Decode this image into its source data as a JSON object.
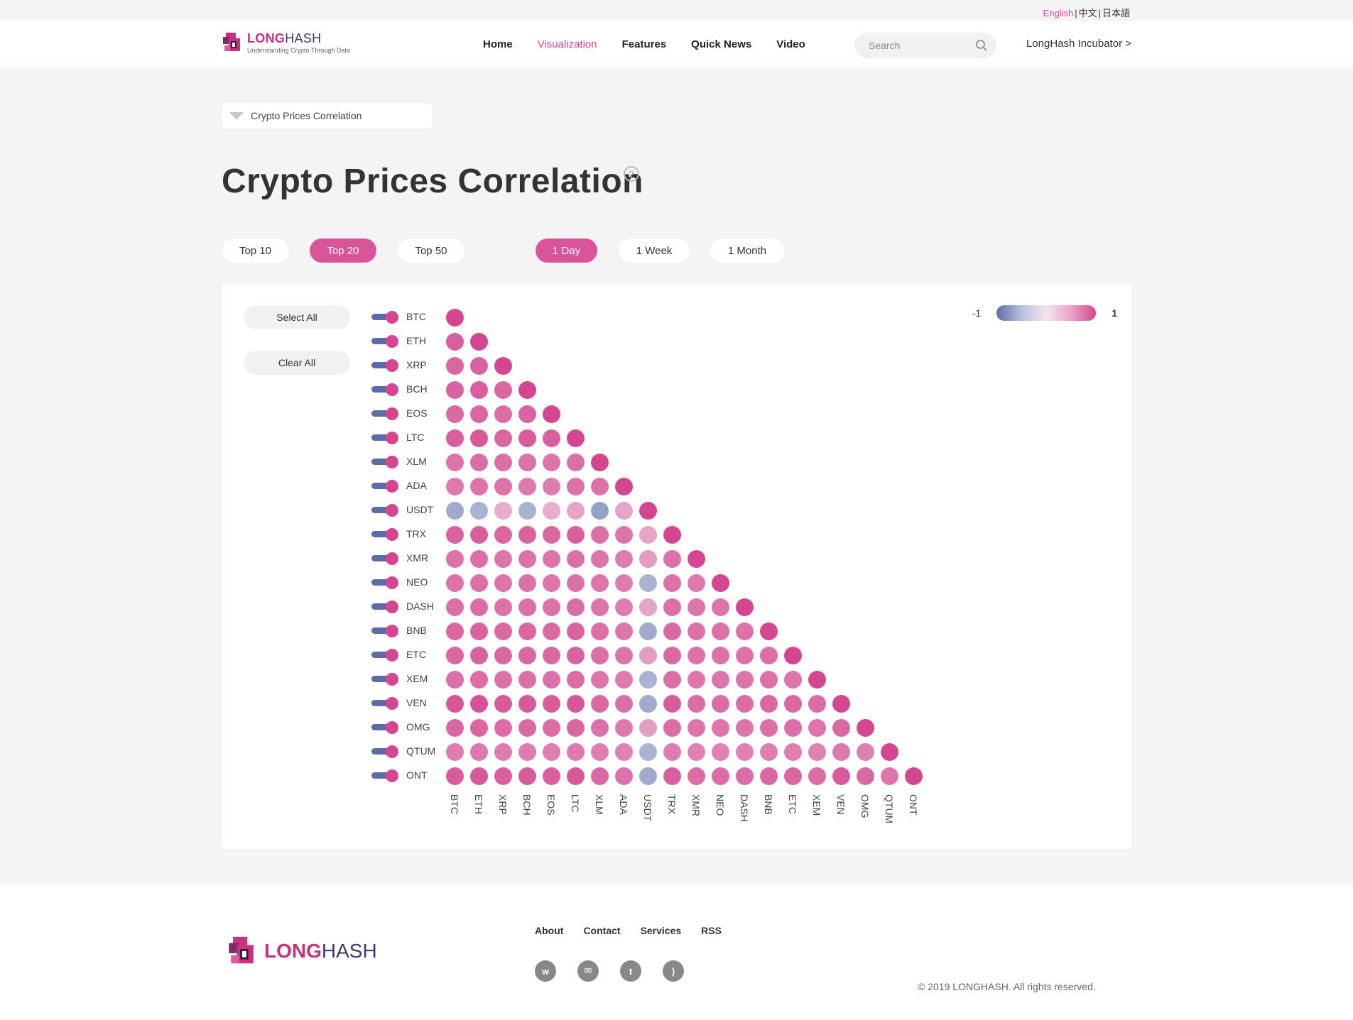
{
  "languages": [
    {
      "label": "English",
      "active": true
    },
    {
      "label": "中文",
      "active": false
    },
    {
      "label": "日本語",
      "active": false
    }
  ],
  "brand": {
    "long": "LONG",
    "hash": "HASH",
    "tagline": "Understanding Crypto Through Data"
  },
  "nav": {
    "items": [
      {
        "label": "Home",
        "active": false
      },
      {
        "label": "Visualization",
        "active": true
      },
      {
        "label": "Features",
        "active": false
      },
      {
        "label": "Quick News",
        "active": false
      },
      {
        "label": "Video",
        "active": false
      }
    ],
    "search_placeholder": "Search",
    "incubator_label": "LongHash Incubator >"
  },
  "dropdown": {
    "selected": "Crypto Prices Correlation"
  },
  "page_title": "Crypto Prices Correlation",
  "help_icon": "question-icon",
  "range_filters": [
    {
      "label": "Top 10",
      "active": false
    },
    {
      "label": "Top 20",
      "active": true
    },
    {
      "label": "Top 50",
      "active": false
    }
  ],
  "time_filters": [
    {
      "label": "1 Day",
      "active": true
    },
    {
      "label": "1 Week",
      "active": false
    },
    {
      "label": "1 Month",
      "active": false
    }
  ],
  "panel": {
    "select_all": "Select All",
    "clear_all": "Clear All"
  },
  "legend": {
    "min_label": "-1",
    "max_label": "1",
    "colors": [
      "#5b6ca8",
      "#f3e6ee",
      "#d4468f"
    ]
  },
  "chart_data": {
    "type": "heatmap",
    "coins": [
      "BTC",
      "ETH",
      "XRP",
      "BCH",
      "EOS",
      "LTC",
      "XLM",
      "ADA",
      "USDT",
      "TRX",
      "XMR",
      "NEO",
      "DASH",
      "BNB",
      "ETC",
      "XEM",
      "VEN",
      "OMG",
      "QTUM",
      "ONT"
    ],
    "value_range": [
      -1,
      1
    ],
    "matrix": [
      [
        1.0
      ],
      [
        0.85,
        1.0
      ],
      [
        0.8,
        0.82,
        1.0
      ],
      [
        0.82,
        0.85,
        0.8,
        1.0
      ],
      [
        0.78,
        0.8,
        0.76,
        0.82,
        1.0
      ],
      [
        0.85,
        0.88,
        0.8,
        0.86,
        0.84,
        1.0
      ],
      [
        0.72,
        0.75,
        0.74,
        0.72,
        0.7,
        0.74,
        1.0
      ],
      [
        0.68,
        0.7,
        0.7,
        0.68,
        0.66,
        0.72,
        0.72,
        1.0
      ],
      [
        -0.35,
        -0.3,
        0.35,
        -0.3,
        0.35,
        0.4,
        -0.4,
        0.4,
        1.0
      ],
      [
        0.82,
        0.85,
        0.8,
        0.82,
        0.8,
        0.84,
        0.74,
        0.7,
        0.4,
        1.0
      ],
      [
        0.72,
        0.74,
        0.7,
        0.72,
        0.7,
        0.74,
        0.7,
        0.66,
        0.45,
        0.72,
        1.0
      ],
      [
        0.72,
        0.74,
        0.7,
        0.72,
        0.7,
        0.74,
        0.7,
        0.66,
        -0.3,
        0.72,
        0.68,
        1.0
      ],
      [
        0.74,
        0.76,
        0.72,
        0.74,
        0.72,
        0.76,
        0.7,
        0.66,
        0.4,
        0.74,
        0.7,
        0.7,
        1.0
      ],
      [
        0.8,
        0.82,
        0.78,
        0.8,
        0.78,
        0.82,
        0.74,
        0.7,
        -0.35,
        0.78,
        0.72,
        0.72,
        0.72,
        1.0
      ],
      [
        0.8,
        0.82,
        0.78,
        0.8,
        0.78,
        0.82,
        0.74,
        0.7,
        0.45,
        0.78,
        0.72,
        0.72,
        0.72,
        0.74,
        1.0
      ],
      [
        0.74,
        0.76,
        0.72,
        0.74,
        0.72,
        0.76,
        0.7,
        0.66,
        -0.3,
        0.74,
        0.7,
        0.7,
        0.7,
        0.72,
        0.7,
        1.0
      ],
      [
        0.9,
        0.92,
        0.86,
        0.88,
        0.86,
        0.9,
        0.78,
        0.74,
        -0.35,
        0.86,
        0.76,
        0.76,
        0.76,
        0.8,
        0.8,
        0.76,
        1.0
      ],
      [
        0.78,
        0.8,
        0.76,
        0.78,
        0.76,
        0.8,
        0.72,
        0.68,
        0.45,
        0.76,
        0.7,
        0.7,
        0.7,
        0.74,
        0.74,
        0.7,
        0.78,
        1.0
      ],
      [
        0.66,
        0.68,
        0.66,
        0.66,
        0.64,
        0.68,
        0.64,
        0.62,
        -0.3,
        0.66,
        0.62,
        0.62,
        0.62,
        0.64,
        0.64,
        0.62,
        0.68,
        0.64,
        1.0
      ],
      [
        0.86,
        0.88,
        0.84,
        0.86,
        0.84,
        0.88,
        0.78,
        0.72,
        -0.35,
        0.84,
        0.76,
        0.76,
        0.76,
        0.8,
        0.8,
        0.76,
        0.86,
        0.78,
        0.7,
        1.0
      ]
    ]
  },
  "footer": {
    "brand_long": "LONG",
    "brand_hash": "HASH",
    "links": [
      "About",
      "Contact",
      "Services",
      "RSS"
    ],
    "socials": [
      {
        "icon": "weibo-icon",
        "glyph": "w"
      },
      {
        "icon": "wechat-icon",
        "glyph": "✉"
      },
      {
        "icon": "twitter-icon",
        "glyph": "t"
      },
      {
        "icon": "rss-icon",
        "glyph": ")"
      }
    ],
    "copyright": "© 2019 LONGHASH. All rights reserved."
  }
}
